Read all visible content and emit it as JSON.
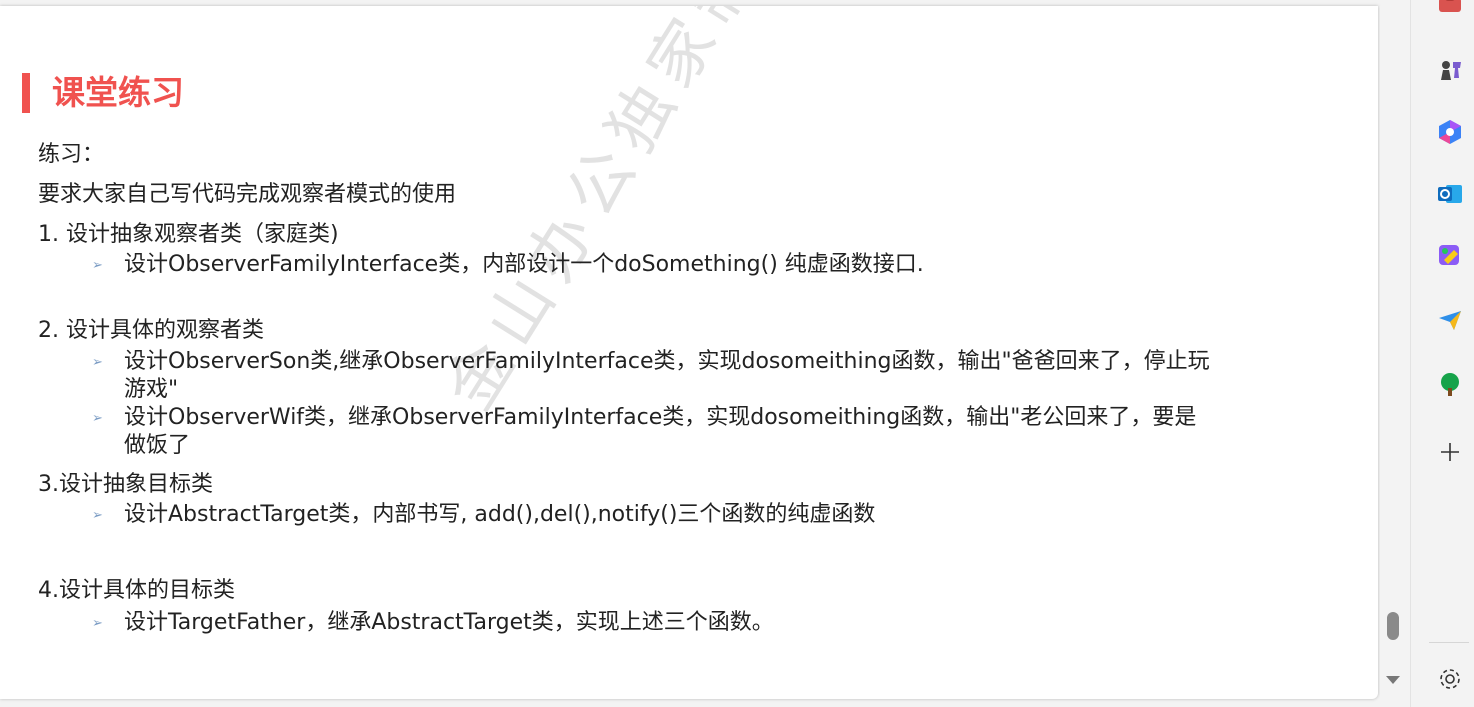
{
  "slide": {
    "title": "课堂练习",
    "watermark": "金山办公独家制作",
    "lines": {
      "l1": "练习：",
      "l2": "要求大家自己写代码完成观察者模式的使用",
      "l3": "1. 设计抽象观察者类（家庭类)",
      "b1": "设计ObserverFamilyInterface类，内部设计一个doSomething() 纯虚函数接口.",
      "l4": "2. 设计具体的观察者类",
      "b2a": "设计ObserverSon类,继承ObserverFamilyInterface类，实现dosomeithing函数，输出\"爸爸回来了，停止玩",
      "b2b": "游戏\"",
      "b3a": "设计ObserverWif类，继承ObserverFamilyInterface类，实现dosomeithing函数，输出\"老公回来了，要是",
      "b3b": "做饭了",
      "l5": "3.设计抽象目标类",
      "b4": "设计AbstractTarget类，内部书写, add(),del(),notify()三个函数的纯虚函数",
      "l6": "4.设计具体的目标类",
      "b5": "设计TargetFather，继承AbstractTarget类，实现上述三个函数。"
    }
  },
  "colors": {
    "accent": "#f0524f",
    "bullet": "#7b9cc4"
  },
  "sidebar": {
    "icons": [
      "toolbox-icon",
      "chess-icon",
      "copilot-icon",
      "outlook-icon",
      "designer-icon",
      "send-icon",
      "tree-icon",
      "add-icon",
      "settings-icon"
    ]
  }
}
